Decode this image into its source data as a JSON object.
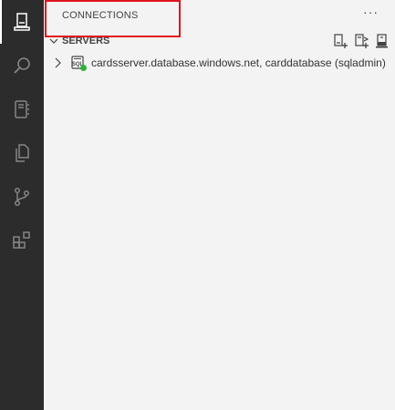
{
  "activity_bar": {
    "items": [
      {
        "name": "connections",
        "icon": "server-icon",
        "active": true
      },
      {
        "name": "search",
        "icon": "search-icon",
        "active": false
      },
      {
        "name": "notebooks",
        "icon": "notebook-icon",
        "active": false
      },
      {
        "name": "explorer",
        "icon": "files-icon",
        "active": false
      },
      {
        "name": "source-control",
        "icon": "source-control-icon",
        "active": false
      },
      {
        "name": "extensions",
        "icon": "extensions-icon",
        "active": false
      }
    ]
  },
  "sidebar": {
    "title": "CONNECTIONS",
    "more_actions_label": "···",
    "section": {
      "label": "SERVERS",
      "expanded": true,
      "actions": [
        {
          "name": "new-connection",
          "icon": "new-connection-icon"
        },
        {
          "name": "new-server-group",
          "icon": "new-server-group-icon"
        },
        {
          "name": "active-connections",
          "icon": "active-connections-icon"
        }
      ]
    },
    "tree": [
      {
        "label": "cardsserver.database.windows.net, carddatabase (sqladmin)",
        "icon_label": "SQL",
        "expanded": false,
        "connected": true
      }
    ]
  },
  "colors": {
    "activity_bar": "#2c2c2c",
    "sidebar": "#f3f3f3",
    "highlight": "#e0141e",
    "connected": "#2cb33b"
  }
}
